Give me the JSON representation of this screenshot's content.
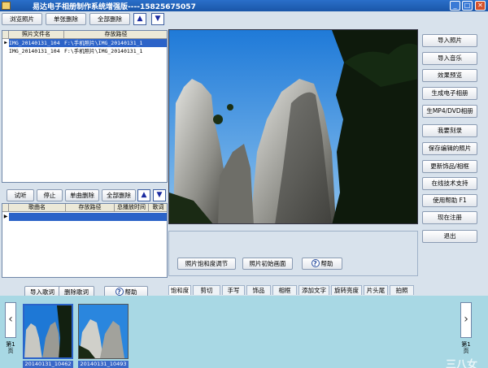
{
  "window": {
    "title": "易达电子相册制作系统增强版----15825675057",
    "minimize": "_",
    "maximize": "□",
    "close": "✕"
  },
  "photo_toolbar": {
    "browse": "浏览照片",
    "delete_one": "单张删除",
    "delete_all": "全部删除",
    "up": "▲",
    "down": "▼"
  },
  "photo_list": {
    "columns": [
      "照片文件名",
      "存放路径"
    ],
    "rows": [
      {
        "marker": "▶",
        "name": "IMG_20140131_104",
        "path": "F:\\手机照片\\IMG_20140131_1",
        "selected": true
      },
      {
        "marker": "",
        "name": "IMG_20140131_104",
        "path": "F:\\手机照片\\IMG_20140131_1",
        "selected": false
      }
    ]
  },
  "music_toolbar": {
    "listen": "试听",
    "stop": "停止",
    "delete_one": "单曲删除",
    "delete_all": "全部删除",
    "up": "▲",
    "down": "▼"
  },
  "music_list": {
    "columns": [
      "歌曲名",
      "存放路径",
      "总播放时间",
      "歌词"
    ],
    "marker": "▶"
  },
  "lyrics_toolbar": {
    "import": "导入歌词",
    "delete": "删除歌词",
    "help": "帮助"
  },
  "preview_tools": {
    "saturation": "照片饱和度调节",
    "reset": "照片初始画面",
    "help": "帮助"
  },
  "side_buttons": [
    "导入照片",
    "导入音乐",
    "效果预览",
    "生成电子相册",
    "生MP4/DVD相册",
    "我要刻录",
    "保存编辑的照片",
    "更新饰品/相框",
    "在线技术支持",
    "使用帮助  F1",
    "现在注册",
    "退出"
  ],
  "tabs": [
    "饱和度",
    "剪切",
    "手写",
    "饰品",
    "相框",
    "添加文字",
    "旋转亮度",
    "片头尾",
    "拍照"
  ],
  "thumbnails": {
    "prev": "‹",
    "next": "›",
    "page_left": "第1页",
    "page_right": "第1页",
    "items": [
      "20140131_10462",
      "20140131_10493"
    ]
  },
  "watermark": "三八女"
}
